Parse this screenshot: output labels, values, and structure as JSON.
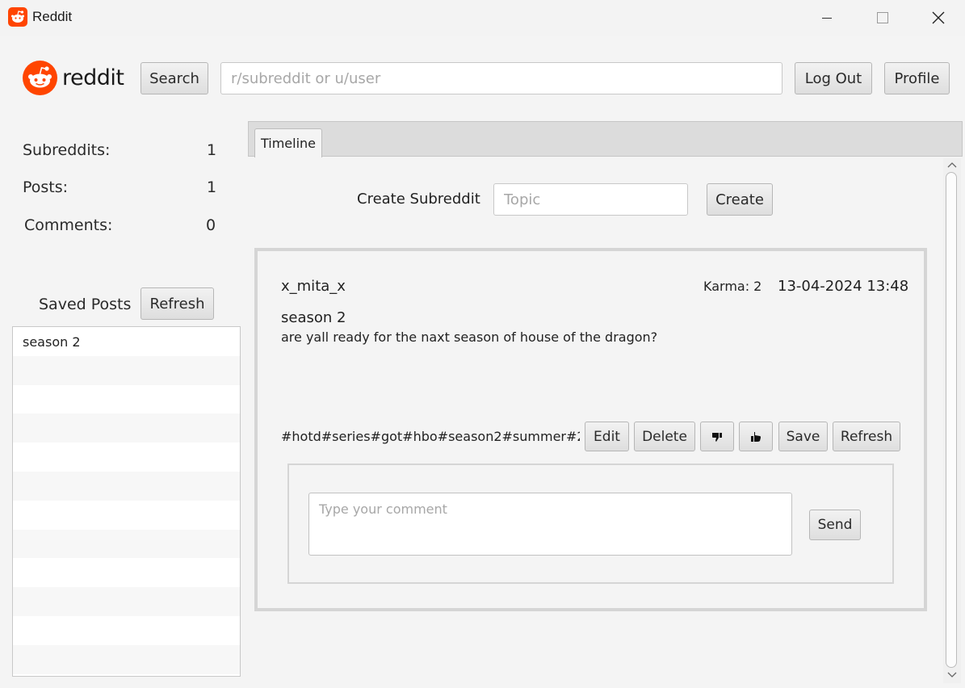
{
  "window": {
    "title": "Reddit",
    "minimize_icon": "minimize-icon",
    "maximize_icon": "maximize-icon",
    "close_icon": "close-icon"
  },
  "header": {
    "logo_text": "reddit",
    "search_label": "Search",
    "search_placeholder": "r/subreddit or u/user",
    "search_value": "",
    "logout_label": "Log Out",
    "profile_label": "Profile"
  },
  "stats": {
    "subreddits_label": "Subreddits:",
    "subreddits_value": "1",
    "posts_label": "Posts:",
    "posts_value": "1",
    "comments_label": "Comments:",
    "comments_value": "0"
  },
  "saved": {
    "title": "Saved Posts",
    "refresh_label": "Refresh",
    "items": [
      "season 2"
    ]
  },
  "tabs": [
    {
      "label": "Timeline"
    }
  ],
  "create": {
    "label": "Create Subreddit",
    "placeholder": "Topic",
    "value": "",
    "button_label": "Create"
  },
  "post": {
    "author": "x_mita_x",
    "karma": "Karma: 2",
    "datetime": "13-04-2024 13:48",
    "title": "season 2",
    "body": "are yall ready for the naxt season of house of the dragon?",
    "tags": "#hotd#series#got#hbo#season2#summer#2...",
    "edit_label": "Edit",
    "delete_label": "Delete",
    "downvote_icon": "thumbs-down-icon",
    "upvote_icon": "thumbs-up-icon",
    "save_label": "Save",
    "refresh_label": "Refresh"
  },
  "comment": {
    "placeholder": "Type your comment",
    "value": "",
    "send_label": "Send"
  },
  "colors": {
    "brand": "#ff4500"
  }
}
